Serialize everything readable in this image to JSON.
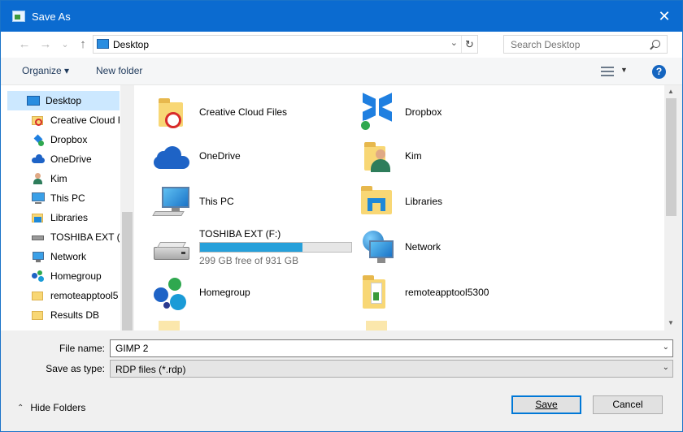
{
  "window": {
    "title": "Save As",
    "close_glyph": "✕"
  },
  "nav_buttons": {
    "back": "←",
    "forward": "→",
    "recent": "⌄",
    "up": "↑"
  },
  "address": {
    "path": "Desktop",
    "chevron": "⌄",
    "refresh": "↻"
  },
  "search": {
    "placeholder": "Search Desktop"
  },
  "toolbar": {
    "organize": "Organize ▾",
    "new_folder": "New folder",
    "view_chevron": "▼",
    "help": "?"
  },
  "sidebar": {
    "items": [
      {
        "label": "Desktop",
        "icon": "desktop-icon",
        "selected": true
      },
      {
        "label": "Creative Cloud F",
        "icon": "creative-cloud-folder-icon"
      },
      {
        "label": "Dropbox",
        "icon": "dropbox-icon"
      },
      {
        "label": "OneDrive",
        "icon": "onedrive-icon"
      },
      {
        "label": "Kim",
        "icon": "user-icon"
      },
      {
        "label": "This PC",
        "icon": "computer-icon"
      },
      {
        "label": "Libraries",
        "icon": "libraries-icon"
      },
      {
        "label": "TOSHIBA EXT (F:",
        "icon": "drive-icon"
      },
      {
        "label": "Network",
        "icon": "network-icon"
      },
      {
        "label": "Homegroup",
        "icon": "homegroup-icon"
      },
      {
        "label": "remoteapptool5",
        "icon": "folder-icon"
      },
      {
        "label": "Results DB",
        "icon": "folder-icon"
      }
    ]
  },
  "content": {
    "items": [
      {
        "label": "Creative Cloud Files",
        "icon": "creative-cloud-folder-icon"
      },
      {
        "label": "Dropbox",
        "icon": "dropbox-icon"
      },
      {
        "label": "OneDrive",
        "icon": "onedrive-icon"
      },
      {
        "label": "Kim",
        "icon": "user-folder-icon"
      },
      {
        "label": "This PC",
        "icon": "computer-icon"
      },
      {
        "label": "Libraries",
        "icon": "libraries-icon"
      },
      {
        "label": "TOSHIBA EXT (F:)",
        "icon": "drive-icon",
        "free_text": "299 GB free of 931 GB",
        "used_fraction": 0.68
      },
      {
        "label": "Network",
        "icon": "network-icon"
      },
      {
        "label": "Homegroup",
        "icon": "homegroup-icon"
      },
      {
        "label": "remoteapptool5300",
        "icon": "folder-icon"
      }
    ]
  },
  "fields": {
    "file_name_label": "File name:",
    "file_name_value": "GIMP 2",
    "save_type_label": "Save as type:",
    "save_type_value": "RDP files (*.rdp)",
    "chevron": "⌄"
  },
  "footer": {
    "hide_folders": "Hide Folders",
    "caret": "⌃",
    "save": "Save",
    "cancel": "Cancel"
  },
  "colors": {
    "titlebar": "#0b6bd0",
    "selection": "#cce8ff",
    "drive_fill": "#26a0da",
    "help": "#1565c0"
  }
}
